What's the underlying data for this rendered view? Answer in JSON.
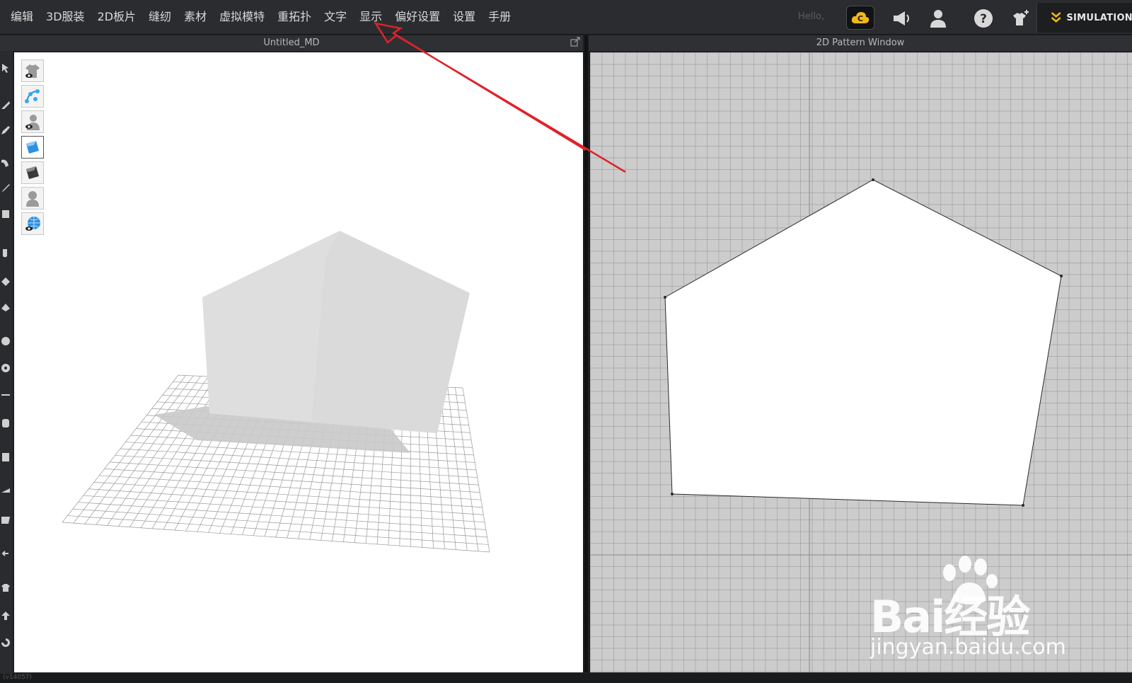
{
  "menubar": {
    "items": [
      "编辑",
      "3D服装",
      "2D板片",
      "缝纫",
      "素材",
      "虚拟模特",
      "重拓扑",
      "文字",
      "显示",
      "偏好设置",
      "设置",
      "手册"
    ],
    "greeting": "Hello,",
    "simulation_label": "SIMULATION"
  },
  "panels": {
    "left_title": "Untitled_MD",
    "right_title": "2D Pattern Window"
  },
  "viewport_tools": [
    "garment-view-icon",
    "avatar-joints-icon",
    "avatar-view-icon",
    "fabric-texture-icon",
    "fabric-solid-icon",
    "avatar-silhouette-icon",
    "environment-globe-icon"
  ],
  "watermark": {
    "brand": "Bai经验",
    "url": "jingyan.baidu.com"
  },
  "status": {
    "text": "(v14057)"
  },
  "colors": {
    "accent": "#f3b714",
    "annotation": "#e0222a",
    "menubar_bg": "#2b2c2f"
  }
}
